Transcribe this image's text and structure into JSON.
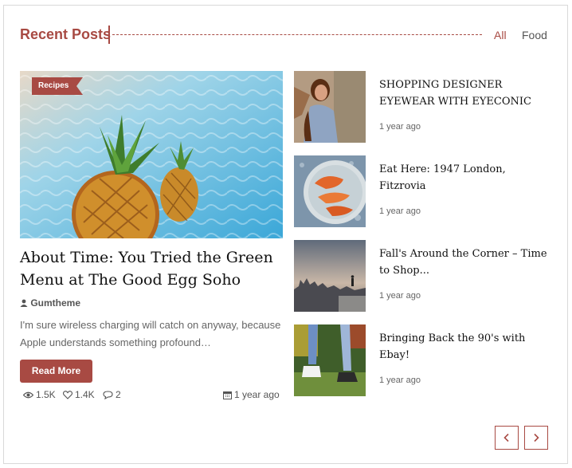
{
  "widget": {
    "title": "Recent Posts",
    "tabs": [
      {
        "label": "All",
        "active": true
      },
      {
        "label": "Food",
        "active": false
      }
    ]
  },
  "featured": {
    "category": "Recipes",
    "title": "About Time: You Tried the Green Menu at The Good Egg Soho",
    "author": "Gumtheme",
    "excerpt": "I'm sure wireless charging will catch on anyway, because Apple understands something profound…",
    "read_more": "Read More",
    "views": "1.5K",
    "likes": "1.4K",
    "comments": "2",
    "date": "1 year ago"
  },
  "posts": [
    {
      "title": "SHOPPING DESIGNER EYEWEAR WITH EYECONIC",
      "date": "1 year ago"
    },
    {
      "title": "Eat Here: 1947 London, Fitzrovia",
      "date": "1 year ago"
    },
    {
      "title": "Fall's Around the Corner – Time to Shop...",
      "date": "1 year ago"
    },
    {
      "title": "Bringing Back the 90's with Ebay!",
      "date": "1 year ago"
    }
  ],
  "colors": {
    "accent": "#a84a43",
    "text": "#111111",
    "muted": "#666666"
  },
  "icons": [
    "user-icon",
    "eye-icon",
    "heart-icon",
    "comment-icon",
    "calendar-icon",
    "chevron-left-icon",
    "chevron-right-icon"
  ]
}
